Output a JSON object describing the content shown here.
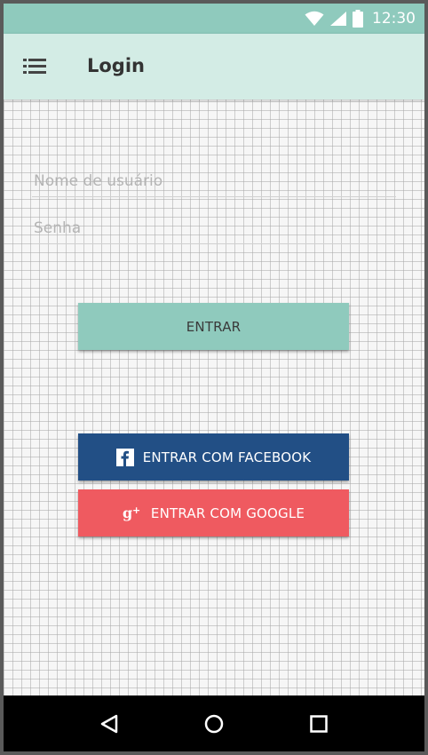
{
  "status_bar": {
    "time": "12:30",
    "icons": [
      "wifi-icon",
      "signal-icon",
      "battery-icon"
    ]
  },
  "app_bar": {
    "title": "Login",
    "menu_icon": "menu-icon"
  },
  "form": {
    "username_placeholder": "Nome de usuário",
    "username_value": "",
    "password_placeholder": "Senha",
    "password_value": ""
  },
  "buttons": {
    "login_label": "ENTRAR",
    "facebook_label": "ENTRAR COM FACEBOOK",
    "google_label": "ENTRAR COM GOOGLE"
  },
  "nav_bar": {
    "icons": [
      "back-icon",
      "home-icon",
      "recents-icon"
    ]
  },
  "colors": {
    "status_bar": "#8fcabd",
    "app_bar": "#d3ece5",
    "login_button": "#8fcabd",
    "facebook_button": "#224f85",
    "google_button": "#ef5a60"
  }
}
